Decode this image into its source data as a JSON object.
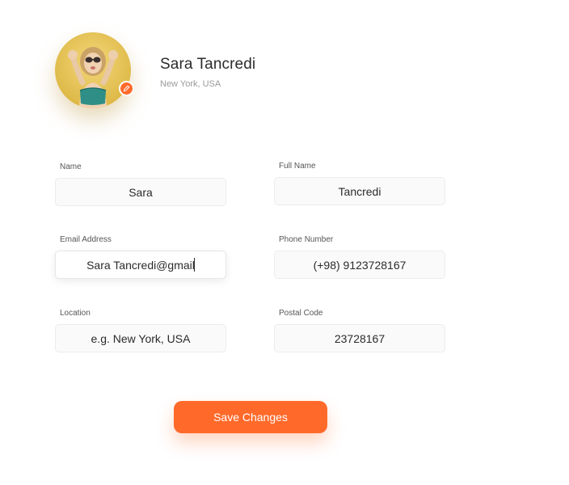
{
  "profile": {
    "name": "Sara Tancredi",
    "location": "New York, USA",
    "edit_icon": "pencil-icon"
  },
  "form": {
    "name": {
      "label": "Name",
      "value": "Sara"
    },
    "full_name": {
      "label": "Full Name",
      "value": "Tancredi"
    },
    "email": {
      "label": "Email Address",
      "value": "Sara Tancredi@gmail"
    },
    "phone": {
      "label": "Phone Number",
      "value": "(+98) 9123728167"
    },
    "location": {
      "label": "Location",
      "placeholder": "e.g. New York, USA"
    },
    "postal_code": {
      "label": "Postal Code",
      "value": "23728167"
    }
  },
  "actions": {
    "save_label": "Save Changes"
  },
  "colors": {
    "accent": "#ff6a2b",
    "field_bg": "#fafafa",
    "text": "#2b2b2b",
    "muted": "#9a9a9a"
  }
}
